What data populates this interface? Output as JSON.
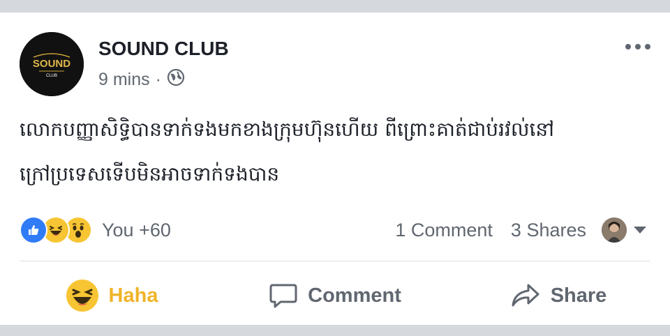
{
  "post": {
    "page_name": "SOUND CLUB",
    "avatar_text_main": "SOUND",
    "avatar_text_sub": "CLUB",
    "time": "9 mins",
    "separator": "·",
    "privacy_icon": "globe-icon",
    "text_line1": "លោកបញ្ញាសិទ្ធិបានទាក់ទងមកខាងក្រុមហ៊ុនហើយ ពីព្រោះគាត់ជាប់រវល់នៅ",
    "text_line2": "ក្រៅប្រទេសទើបមិនអាចទាក់ទងបាន"
  },
  "reactions": {
    "icons": [
      "like-icon",
      "haha-icon",
      "wow-icon"
    ],
    "count_label": "You +60"
  },
  "stats": {
    "comments": "1 Comment",
    "shares": "3 Shares"
  },
  "actions": {
    "haha": "Haha",
    "comment": "Comment",
    "share": "Share"
  },
  "colors": {
    "like": "#2f7cf6",
    "haha": "#f0b429",
    "text": "#1d2129",
    "muted": "#606770"
  }
}
